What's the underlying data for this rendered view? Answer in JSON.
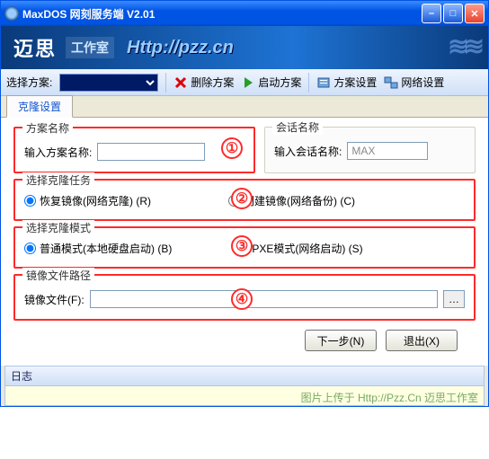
{
  "window": {
    "title": "MaxDOS 网刻服务端 V2.01"
  },
  "banner": {
    "brand": "迈思",
    "sub": "工作室",
    "url": "Http://pzz.cn"
  },
  "toolbar": {
    "select_label": "选择方案:",
    "delete_label": "删除方案",
    "start_label": "启动方案",
    "plan_settings_label": "方案设置",
    "net_settings_label": "网络设置"
  },
  "tabs": {
    "clone": "克隆设置"
  },
  "groups": {
    "plan_name": {
      "legend": "方案名称",
      "field_label": "输入方案名称:",
      "value": ""
    },
    "session_name": {
      "legend": "会话名称",
      "field_label": "输入会话名称:",
      "value": "MAX"
    },
    "task": {
      "legend": "选择克隆任务",
      "opt1": "恢复镜像(网络克隆)  (R)",
      "opt2": "创建镜像(网络备份)  (C)"
    },
    "mode": {
      "legend": "选择克隆模式",
      "opt1": "普通模式(本地硬盘启动)  (B)",
      "opt2": "PXE模式(网络启动)  (S)"
    },
    "path": {
      "legend": "镜像文件路径",
      "field_label": "镜像文件(F):"
    }
  },
  "annotations": {
    "a1": "①",
    "a2": "②",
    "a3": "③",
    "a4": "④"
  },
  "buttons": {
    "next": "下一步(N)",
    "exit": "退出(X)"
  },
  "log": {
    "header": "日志",
    "footer": "图片上传于 Http://Pzz.Cn 迈思工作室"
  }
}
